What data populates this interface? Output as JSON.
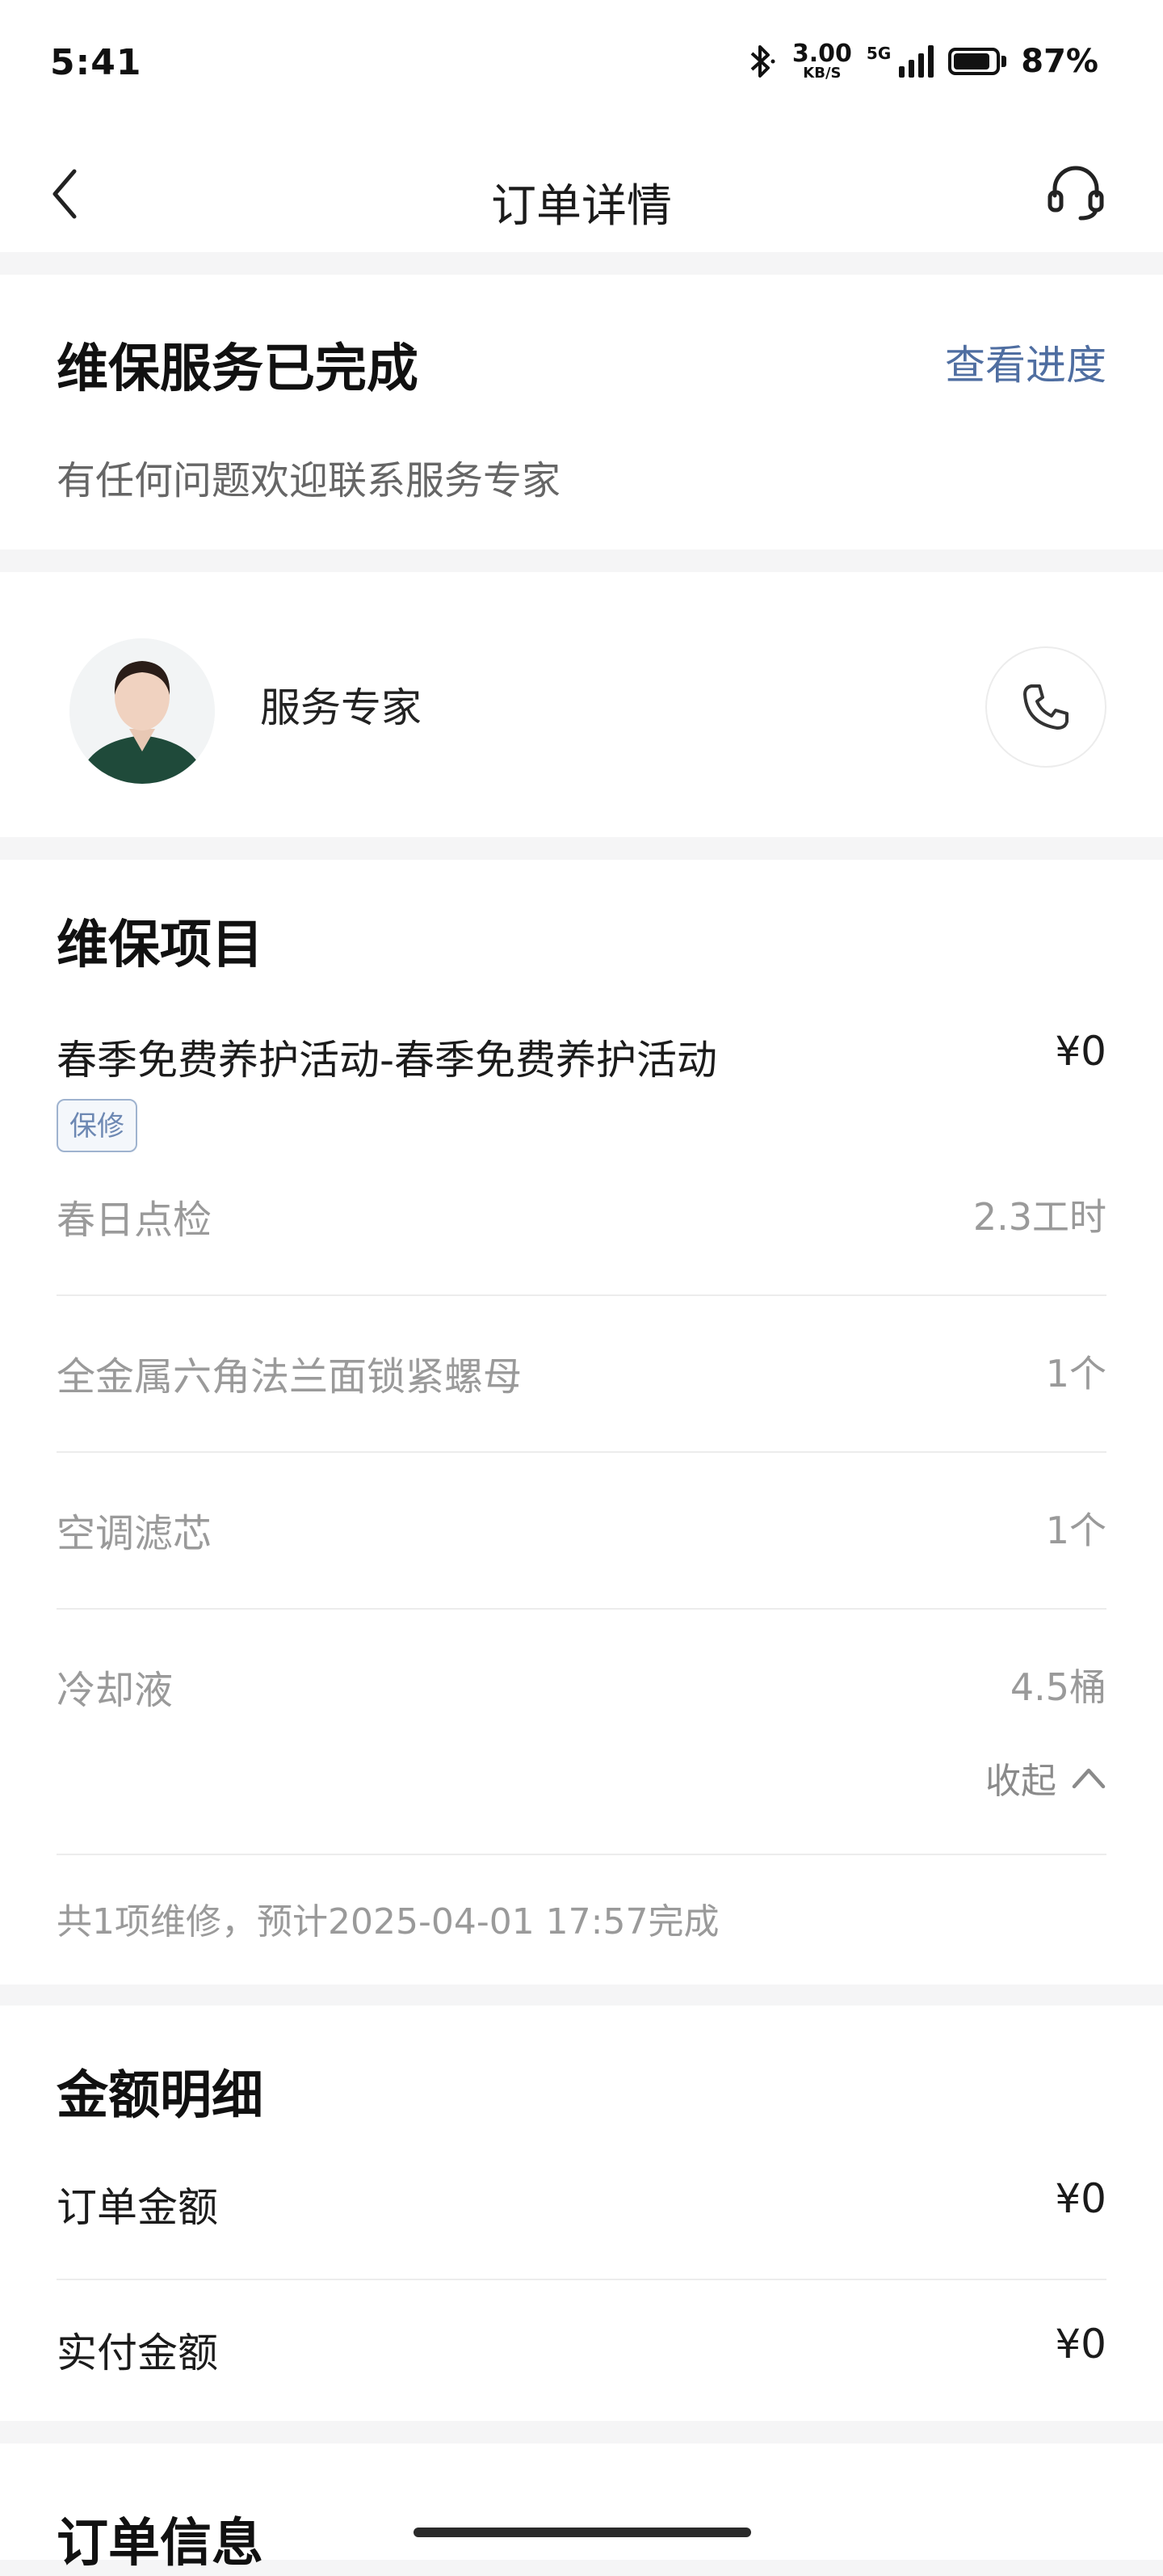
{
  "status_bar": {
    "time": "5:41",
    "net_speed_value": "3.00",
    "net_speed_unit": "KB/S",
    "network_label": "5G",
    "battery": "87%",
    "battery_level": 0.87
  },
  "navbar": {
    "title": "订单详情"
  },
  "service_status": {
    "title": "维保服务已完成",
    "progress_link": "查看进度",
    "subtitle": "有任何问题欢迎联系服务专家"
  },
  "expert": {
    "label": "服务专家"
  },
  "maintenance": {
    "section_title": "维保项目",
    "main_item": {
      "name": "春季免费养护活动-春季免费养护活动",
      "price": "¥0",
      "tag": "保修"
    },
    "sub_items": [
      {
        "name": "春日点检",
        "qty": "2.3工时"
      },
      {
        "name": "全金属六角法兰面锁紧螺母",
        "qty": "1个"
      },
      {
        "name": "空调滤芯",
        "qty": "1个"
      },
      {
        "name": "冷却液",
        "qty": "4.5桶"
      }
    ],
    "collapse_label": "收起",
    "summary": "共1项维修，预计2025-04-01 17:57完成"
  },
  "amount": {
    "section_title": "金额明细",
    "rows": [
      {
        "label": "订单金额",
        "value": "¥0"
      },
      {
        "label": "实付金额",
        "value": "¥0"
      }
    ]
  },
  "order_info": {
    "section_title_partial": "订单信息"
  },
  "colors": {
    "accent_link": "#4f6ea1",
    "tag_border": "#9fb3cf",
    "page_bg": "#f5f5f6"
  }
}
